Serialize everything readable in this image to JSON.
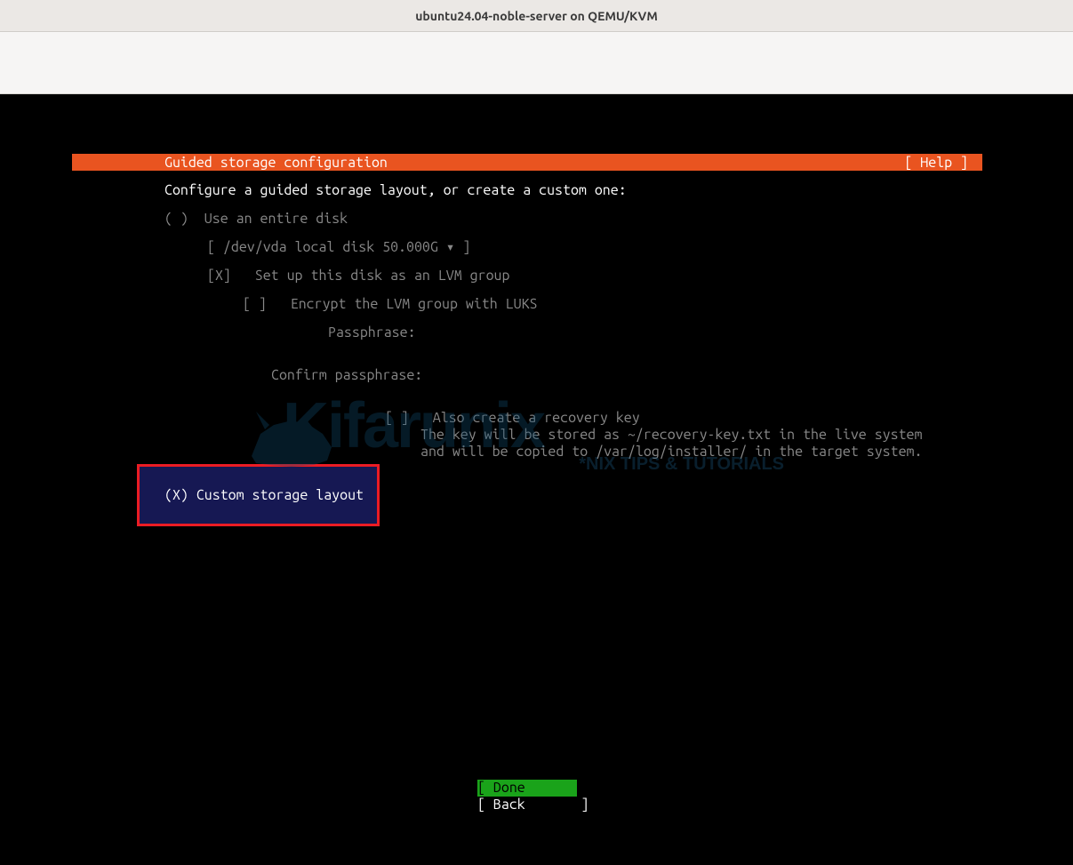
{
  "window": {
    "title": "ubuntu24.04-noble-server on QEMU/KVM"
  },
  "header": {
    "title": "Guided storage configuration",
    "help": "[ Help ]"
  },
  "content": {
    "intro": "Configure a guided storage layout, or create a custom one:",
    "opt_entire_disk": "( )  Use an entire disk",
    "disk_select": "[ /dev/vda local disk 50.000G ▾ ]",
    "lvm_check": "[X]   Set up this disk as an LVM group",
    "luks_check": "[ ]   Encrypt the LVM group with LUKS",
    "pass_label": "Passphrase:",
    "confirm_label": "Confirm passphrase:",
    "recovery_check": "[ ]   Also create a recovery key",
    "recovery_hint1": "The key will be stored as ~/recovery-key.txt in the live system",
    "recovery_hint2": "and will be copied to /var/log/installer/ in the target system.",
    "opt_custom": "(X)  Custom storage layout"
  },
  "footer": {
    "done": "[ Done       ]",
    "back": "[ Back       ]"
  },
  "watermark": {
    "brand": "Kifarunix",
    "tagline": "*NIX TIPS & TUTORIALS"
  }
}
